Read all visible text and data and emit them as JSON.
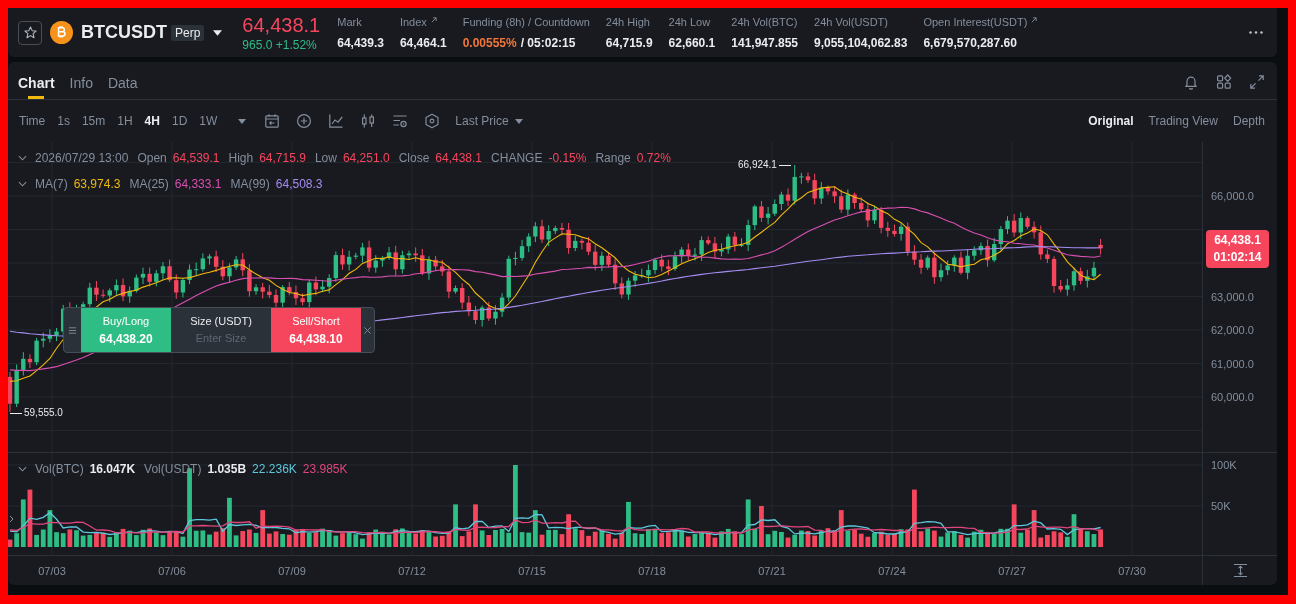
{
  "header": {
    "symbol": "BTCUSDT",
    "badge": "Perp",
    "price": "64,438.1",
    "change": "965.0 +1.52%",
    "stats": [
      {
        "label": "Mark",
        "value": "64,439.3",
        "link": false
      },
      {
        "label": "Index",
        "value": "64,464.1",
        "link": true
      },
      {
        "label": "Funding (8h) / Countdown",
        "value": "0.00555%",
        "countdown": "/ 05:02:15",
        "link": false
      },
      {
        "label": "24h High",
        "value": "64,715.9",
        "link": false
      },
      {
        "label": "24h Low",
        "value": "62,660.1",
        "link": false
      },
      {
        "label": "24h Vol(BTC)",
        "value": "141,947.855",
        "link": false
      },
      {
        "label": "24h Vol(USDT)",
        "value": "9,055,104,062.83",
        "link": false
      },
      {
        "label": "Open Interest(USDT)",
        "value": "6,679,570,287.60",
        "link": true
      }
    ]
  },
  "tabs": [
    {
      "label": "Chart",
      "selected": true
    },
    {
      "label": "Info",
      "selected": false
    },
    {
      "label": "Data",
      "selected": false
    }
  ],
  "toolbar": {
    "intervals": [
      {
        "label": "Time",
        "selected": false
      },
      {
        "label": "1s",
        "selected": false
      },
      {
        "label": "15m",
        "selected": false
      },
      {
        "label": "1H",
        "selected": false
      },
      {
        "label": "4H",
        "selected": true
      },
      {
        "label": "1D",
        "selected": false
      },
      {
        "label": "1W",
        "selected": false
      }
    ],
    "price_source": "Last Price",
    "views": [
      {
        "label": "Original",
        "selected": true
      },
      {
        "label": "Trading View",
        "selected": false
      },
      {
        "label": "Depth",
        "selected": false
      }
    ]
  },
  "chart": {
    "candle_info": {
      "time": "2026/07/29 13:00",
      "fields": [
        {
          "label": "Open",
          "value": "64,539.1"
        },
        {
          "label": "High",
          "value": "64,715.9"
        },
        {
          "label": "Low",
          "value": "64,251.0"
        },
        {
          "label": "Close",
          "value": "64,438.1"
        },
        {
          "label": "CHANGE",
          "value": "-0.15%"
        },
        {
          "label": "Range",
          "value": "0.72%"
        }
      ]
    },
    "moving_averages": [
      {
        "label": "MA(7)",
        "value": "63,974.3",
        "color": "#f0b90b"
      },
      {
        "label": "MA(25)",
        "value": "64,333.1",
        "color": "#d94fb0"
      },
      {
        "label": "MA(99)",
        "value": "64,508.3",
        "color": "#a58cf0"
      }
    ],
    "high_marker": "66,924.1",
    "low_marker": "59,555.0",
    "price_axis": [
      "66,000.0",
      "63,000.0",
      "62,000.0",
      "61,000.0",
      "60,000.0"
    ],
    "last_price": {
      "price": "64,438.1",
      "countdown": "01:02:14"
    },
    "quick_trade": {
      "buy_label": "Buy/Long",
      "buy_price": "64,438.20",
      "size_label": "Size (USDT)",
      "size_placeholder": "Enter Size",
      "sell_label": "Sell/Short",
      "sell_price": "64,438.10"
    }
  },
  "volume": {
    "legend": [
      {
        "label": "Vol(BTC)",
        "value": "16.047K"
      },
      {
        "label": "Vol(USDT)",
        "value": "1.035B"
      }
    ],
    "averages": [
      {
        "value": "22.236K",
        "color": "#5cc8dc"
      },
      {
        "value": "23.985K",
        "color": "#e0467c"
      }
    ],
    "axis": [
      "100K",
      "50K"
    ]
  },
  "time_axis": [
    "07/03",
    "07/06",
    "07/09",
    "07/12",
    "07/15",
    "07/18",
    "07/21",
    "07/24",
    "07/27",
    "07/30"
  ]
}
